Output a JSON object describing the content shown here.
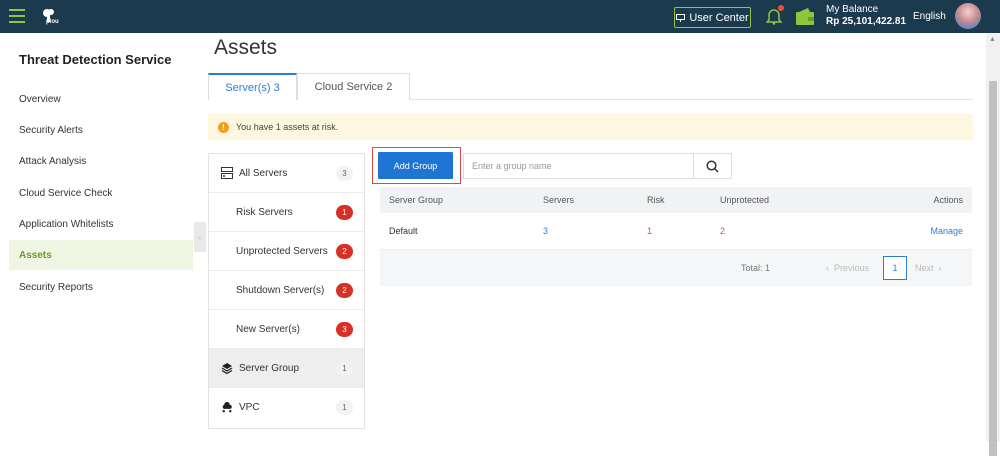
{
  "header": {
    "logo_text": "plou",
    "user_center_label": "User Center",
    "balance_label": "My Balance",
    "balance_value": "Rp 25,101,422.81",
    "language": "English"
  },
  "sidebar": {
    "title": "Threat Detection Service",
    "items": [
      {
        "label": "Overview",
        "active": false
      },
      {
        "label": "Security Alerts",
        "active": false
      },
      {
        "label": "Attack Analysis",
        "active": false
      },
      {
        "label": "Cloud Service Check",
        "active": false
      },
      {
        "label": "Application Whitelists",
        "active": false
      },
      {
        "label": "Assets",
        "active": true
      },
      {
        "label": "Security Reports",
        "active": false
      }
    ]
  },
  "main": {
    "title": "Assets",
    "tabs": [
      {
        "label": "Server(s) 3",
        "active": true
      },
      {
        "label": "Cloud Service 2",
        "active": false
      }
    ],
    "alert_text": "You have 1 assets at risk.",
    "server_panel": [
      {
        "label": "All Servers",
        "count": "3",
        "icon": "server-list-icon",
        "red": false
      },
      {
        "label": "Risk Servers",
        "count": "1",
        "icon": "",
        "red": true
      },
      {
        "label": "Unprotected Servers",
        "count": "2",
        "icon": "",
        "red": true
      },
      {
        "label": "Shutdown Server(s)",
        "count": "2",
        "icon": "",
        "red": true
      },
      {
        "label": "New Server(s)",
        "count": "3",
        "icon": "",
        "red": true
      },
      {
        "label": "Server Group",
        "count": "1",
        "icon": "layers-icon",
        "red": false
      },
      {
        "label": "VPC",
        "count": "1",
        "icon": "cloud-network-icon",
        "red": false
      }
    ],
    "add_group_label": "Add Group",
    "search_placeholder": "Enter a group name",
    "table": {
      "headers": [
        "Server Group",
        "Servers",
        "Risk",
        "Unprotected",
        "Actions"
      ],
      "rows": [
        {
          "group": "Default",
          "servers": "3",
          "risk": "1",
          "unprotected": "2",
          "action": "Manage"
        }
      ],
      "total": "Total: 1",
      "prev": "Previous",
      "page": "1",
      "next": "Next"
    }
  },
  "colors": {
    "topbar": "#1b3a4e",
    "accent_green": "#8dc63f",
    "primary_blue": "#1f75d4",
    "risk_red": "#d93025",
    "link_blue": "#2b7ed6"
  }
}
